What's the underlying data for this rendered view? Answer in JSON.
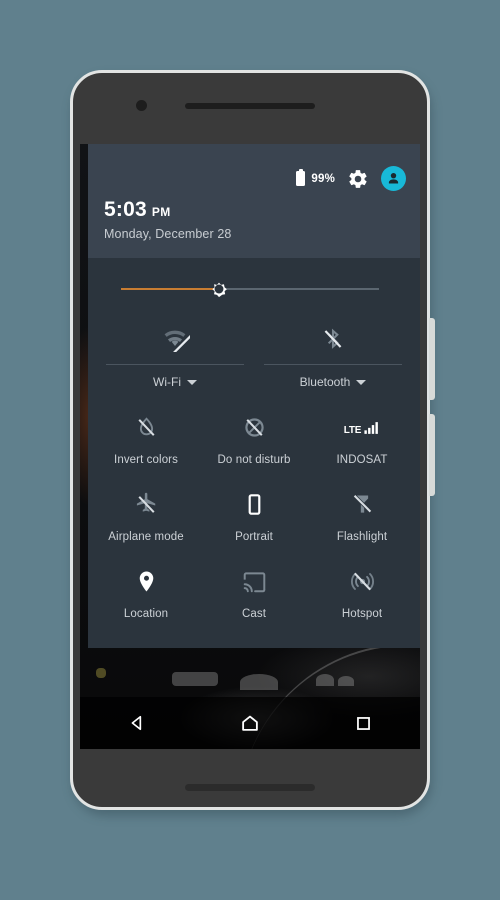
{
  "theme": {
    "page_background": "#60808d",
    "phone_body": "#3a3a3a",
    "phone_outline": "#e2e4e3",
    "panel_background": "#2b343d",
    "panel_header_background": "#3a4450",
    "accent_slider": "#c87d32",
    "avatar_background": "#18b9d8",
    "icon_active": "#ffffff",
    "icon_inactive": "#7c8892",
    "label_color": "#ccd1d6"
  },
  "status_bar": {
    "battery_icon": "battery-full-icon",
    "battery_percent": "99%",
    "settings_icon": "gear-icon",
    "user_icon": "user-avatar-icon"
  },
  "clock": {
    "time": "5:03",
    "meridiem": "PM",
    "date": "Monday, December 28"
  },
  "brightness": {
    "icon": "brightness-sun-icon",
    "value_percent": 38,
    "track_color": "#5b6670",
    "fill_color": "#c87d32"
  },
  "dual_tiles": [
    {
      "label": "Wi-Fi",
      "icon": "wifi-off-icon",
      "state": "off",
      "has_caret": true
    },
    {
      "label": "Bluetooth",
      "icon": "bluetooth-off-icon",
      "state": "off",
      "has_caret": true
    }
  ],
  "tiles": [
    {
      "label": "Invert colors",
      "icon": "invert-colors-off-icon",
      "state": "off"
    },
    {
      "label": "Do not disturb",
      "icon": "do-not-disturb-off-icon",
      "state": "off"
    },
    {
      "label": "INDOSAT",
      "icon": "cellular-lte-signal-icon",
      "state": "on",
      "network_type": "LTE",
      "signal_bars": 4
    },
    {
      "label": "Airplane mode",
      "icon": "airplane-off-icon",
      "state": "off"
    },
    {
      "label": "Portrait",
      "icon": "screen-rotation-portrait-icon",
      "state": "on"
    },
    {
      "label": "Flashlight",
      "icon": "flashlight-off-icon",
      "state": "off"
    },
    {
      "label": "Location",
      "icon": "location-pin-icon",
      "state": "on"
    },
    {
      "label": "Cast",
      "icon": "cast-icon",
      "state": "off"
    },
    {
      "label": "Hotspot",
      "icon": "hotspot-off-icon",
      "state": "off"
    }
  ],
  "navbar": [
    {
      "name": "back",
      "icon": "back-triangle-icon"
    },
    {
      "name": "home",
      "icon": "home-icon"
    },
    {
      "name": "recents",
      "icon": "recents-square-icon"
    }
  ],
  "device": {
    "front_camera": "camera-dot",
    "earpiece": "speaker-grille",
    "power_button": "power-button",
    "volume_button": "volume-button"
  }
}
